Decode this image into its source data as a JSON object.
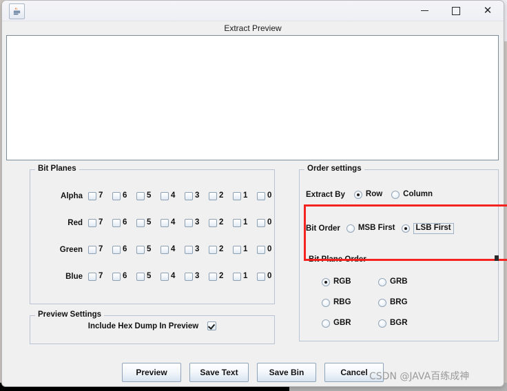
{
  "window": {
    "app_icon": "java-coffee-cup-icon",
    "minimize_label": "–",
    "maximize_label": "□",
    "close_label": "✕",
    "dialog_caption": "Extract Preview"
  },
  "background": {
    "close_label": "✕"
  },
  "preview": {
    "textarea_value": "",
    "textarea_placeholder": ""
  },
  "bit_planes": {
    "legend": "Bit Planes",
    "bit_labels": [
      "7",
      "6",
      "5",
      "4",
      "3",
      "2",
      "1",
      "0"
    ],
    "rows": [
      {
        "label": "Alpha",
        "checked": [
          false,
          false,
          false,
          false,
          false,
          false,
          false,
          false
        ]
      },
      {
        "label": "Red",
        "checked": [
          false,
          false,
          false,
          false,
          false,
          false,
          false,
          false
        ]
      },
      {
        "label": "Green",
        "checked": [
          false,
          false,
          false,
          false,
          false,
          false,
          false,
          false
        ]
      },
      {
        "label": "Blue",
        "checked": [
          false,
          false,
          false,
          false,
          false,
          false,
          false,
          false
        ]
      }
    ]
  },
  "preview_settings": {
    "legend": "Preview Settings",
    "hex_dump_label": "Include Hex Dump In Preview",
    "hex_dump_checked": true
  },
  "order_settings": {
    "legend": "Order settings",
    "extract_by_label": "Extract By",
    "extract_by_options": [
      {
        "label": "Row",
        "selected": true
      },
      {
        "label": "Column",
        "selected": false
      }
    ],
    "bit_order_label": "Bit Order",
    "bit_order_options": [
      {
        "label": "MSB First",
        "selected": false,
        "focused": false
      },
      {
        "label": "LSB First",
        "selected": true,
        "focused": true
      }
    ],
    "bit_plane_order_label": "Bit Plane Order",
    "bit_plane_order_options": [
      {
        "label": "RGB",
        "selected": true
      },
      {
        "label": "GRB",
        "selected": false
      },
      {
        "label": "RBG",
        "selected": false
      },
      {
        "label": "BRG",
        "selected": false
      },
      {
        "label": "GBR",
        "selected": false
      },
      {
        "label": "BGR",
        "selected": false
      }
    ]
  },
  "annotation": {
    "color": "#f5231f"
  },
  "buttons": [
    {
      "label": "Preview"
    },
    {
      "label": "Save Text"
    },
    {
      "label": "Save Bin"
    },
    {
      "label": "Cancel"
    }
  ],
  "watermark": {
    "text": "CSDN @JAVA百练成神"
  },
  "colors": {
    "window_bg": "#f0f0f0",
    "groupbox_border": "#b8c4d4",
    "annotation_red": "#f5231f",
    "textarea_bg": "#ffffff",
    "textarea_border": "#7a8b99",
    "button_border": "#8ea3ba"
  }
}
